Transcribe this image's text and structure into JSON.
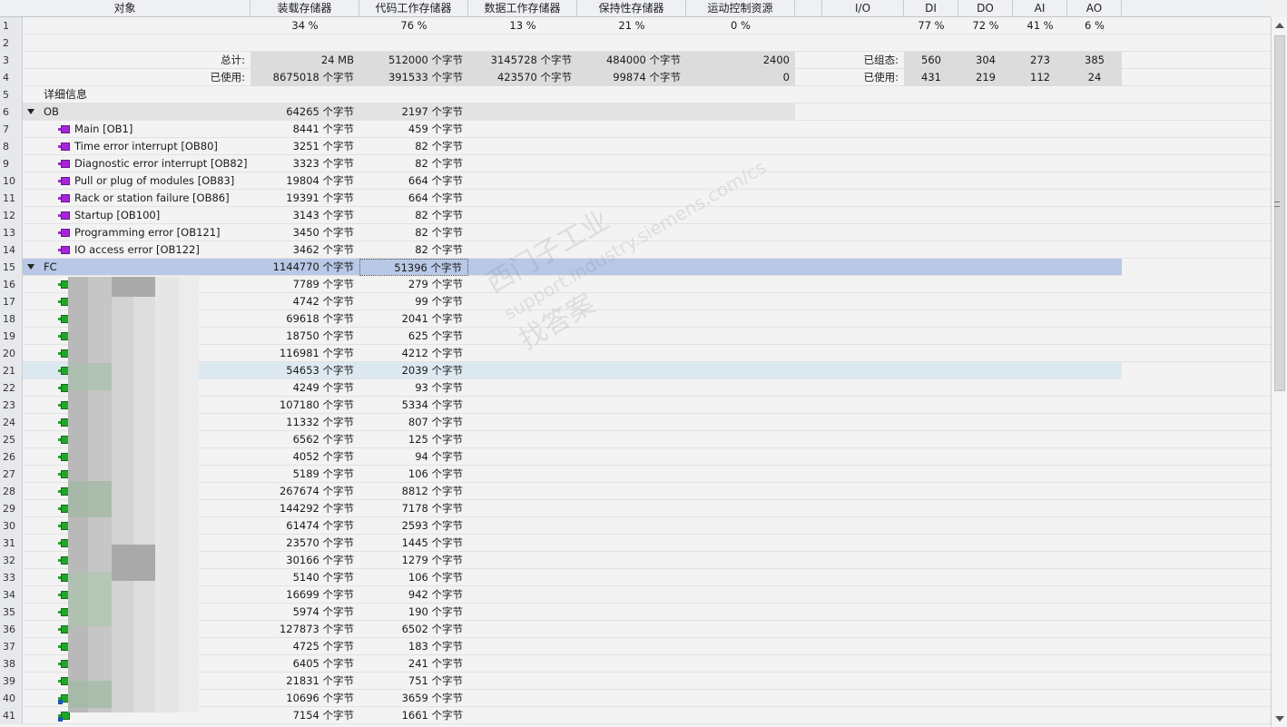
{
  "headers": [
    "对象",
    "装载存储器",
    "代码工作存储器",
    "数据工作存储器",
    "保持性存储器",
    "运动控制资源",
    "",
    "I/O",
    "DI",
    "DO",
    "AI",
    "AO"
  ],
  "percent_row": {
    "num": "1",
    "load": "34 %",
    "code": "76 %",
    "data": "13 %",
    "retain": "21 %",
    "motion": "0 %",
    "di": "77 %",
    "do": "72 %",
    "ai": "41 %",
    "ao": "6 %"
  },
  "blank_row": {
    "num": "2"
  },
  "total_row": {
    "num": "3",
    "label": "总计:",
    "load": "24 MB",
    "code": "512000 个字节",
    "data": "3145728 个字节",
    "retain": "484000 个字节",
    "motion": "2400",
    "io_label": "已组态:",
    "di": "560",
    "do": "304",
    "ai": "273",
    "ao": "385"
  },
  "used_row": {
    "num": "4",
    "label": "已使用:",
    "load": "8675018 个字节",
    "code": "391533 个字节",
    "data": "423570 个字节",
    "retain": "99874 个字节",
    "motion": "0",
    "io_label": "已使用:",
    "di": "431",
    "do": "219",
    "ai": "112",
    "ao": "24"
  },
  "detail_row": {
    "num": "5",
    "label": "详细信息"
  },
  "ob_group": {
    "num": "6",
    "label": "OB",
    "load": "64265 个字节",
    "code": "2197 个字节"
  },
  "ob_rows": [
    {
      "num": "7",
      "name": "Main [OB1]",
      "load": "8441 个字节",
      "code": "459 个字节"
    },
    {
      "num": "8",
      "name": "Time error interrupt [OB80]",
      "load": "3251 个字节",
      "code": "82 个字节"
    },
    {
      "num": "9",
      "name": "Diagnostic error interrupt [OB82]",
      "load": "3323 个字节",
      "code": "82 个字节"
    },
    {
      "num": "10",
      "name": "Pull or plug of modules [OB83]",
      "load": "19804 个字节",
      "code": "664 个字节"
    },
    {
      "num": "11",
      "name": "Rack or station failure [OB86]",
      "load": "19391 个字节",
      "code": "664 个字节"
    },
    {
      "num": "12",
      "name": "Startup [OB100]",
      "load": "3143 个字节",
      "code": "82 个字节"
    },
    {
      "num": "13",
      "name": "Programming error [OB121]",
      "load": "3450 个字节",
      "code": "82 个字节"
    },
    {
      "num": "14",
      "name": "IO access error [OB122]",
      "load": "3462 个字节",
      "code": "82 个字节"
    }
  ],
  "fc_group": {
    "num": "15",
    "label": "FC",
    "load": "1144770 个字节",
    "code": "51396 个字节"
  },
  "fc_rows": [
    {
      "num": "16",
      "load": "7789 个字节",
      "code": "279 个字节"
    },
    {
      "num": "17",
      "load": "4742 个字节",
      "code": "99 个字节"
    },
    {
      "num": "18",
      "load": "69618 个字节",
      "code": "2041 个字节"
    },
    {
      "num": "19",
      "load": "18750 个字节",
      "code": "625 个字节"
    },
    {
      "num": "20",
      "load": "116981 个字节",
      "code": "4212 个字节"
    },
    {
      "num": "21",
      "load": "54653 个字节",
      "code": "2039 个字节"
    },
    {
      "num": "22",
      "load": "4249 个字节",
      "code": "93 个字节"
    },
    {
      "num": "23",
      "load": "107180 个字节",
      "code": "5334 个字节"
    },
    {
      "num": "24",
      "load": "11332 个字节",
      "code": "807 个字节"
    },
    {
      "num": "25",
      "load": "6562 个字节",
      "code": "125 个字节"
    },
    {
      "num": "26",
      "load": "4052 个字节",
      "code": "94 个字节"
    },
    {
      "num": "27",
      "load": "5189 个字节",
      "code": "106 个字节"
    },
    {
      "num": "28",
      "load": "267674 个字节",
      "code": "8812 个字节"
    },
    {
      "num": "29",
      "load": "144292 个字节",
      "code": "7178 个字节"
    },
    {
      "num": "30",
      "load": "61474 个字节",
      "code": "2593 个字节"
    },
    {
      "num": "31",
      "load": "23570 个字节",
      "code": "1445 个字节"
    },
    {
      "num": "32",
      "load": "30166 个字节",
      "code": "1279 个字节"
    },
    {
      "num": "33",
      "load": "5140 个字节",
      "code": "106 个字节"
    },
    {
      "num": "34",
      "load": "16699 个字节",
      "code": "942 个字节"
    },
    {
      "num": "35",
      "load": "5974 个字节",
      "code": "190 个字节"
    },
    {
      "num": "36",
      "load": "127873 个字节",
      "code": "6502 个字节"
    },
    {
      "num": "37",
      "load": "4725 个字节",
      "code": "183 个字节"
    },
    {
      "num": "38",
      "load": "6405 个字节",
      "code": "241 个字节"
    },
    {
      "num": "39",
      "load": "21831 个字节",
      "code": "751 个字节"
    },
    {
      "num": "40",
      "load": "10696 个字节",
      "code": "3659 个字节"
    },
    {
      "num": "41",
      "load": "7154 个字节",
      "code": "1661 个字节"
    }
  ],
  "watermark": {
    "line1": "西门子工业",
    "line2": "support.industry.siemens.com/cs",
    "line3": "找答案"
  },
  "colors": {
    "selected_row": "#b8c8e6",
    "hover_row": "#dde9f1",
    "ob_icon": "#a426d6",
    "fc_icon": "#21a62a",
    "summary_shade": "#dcdcdc"
  }
}
